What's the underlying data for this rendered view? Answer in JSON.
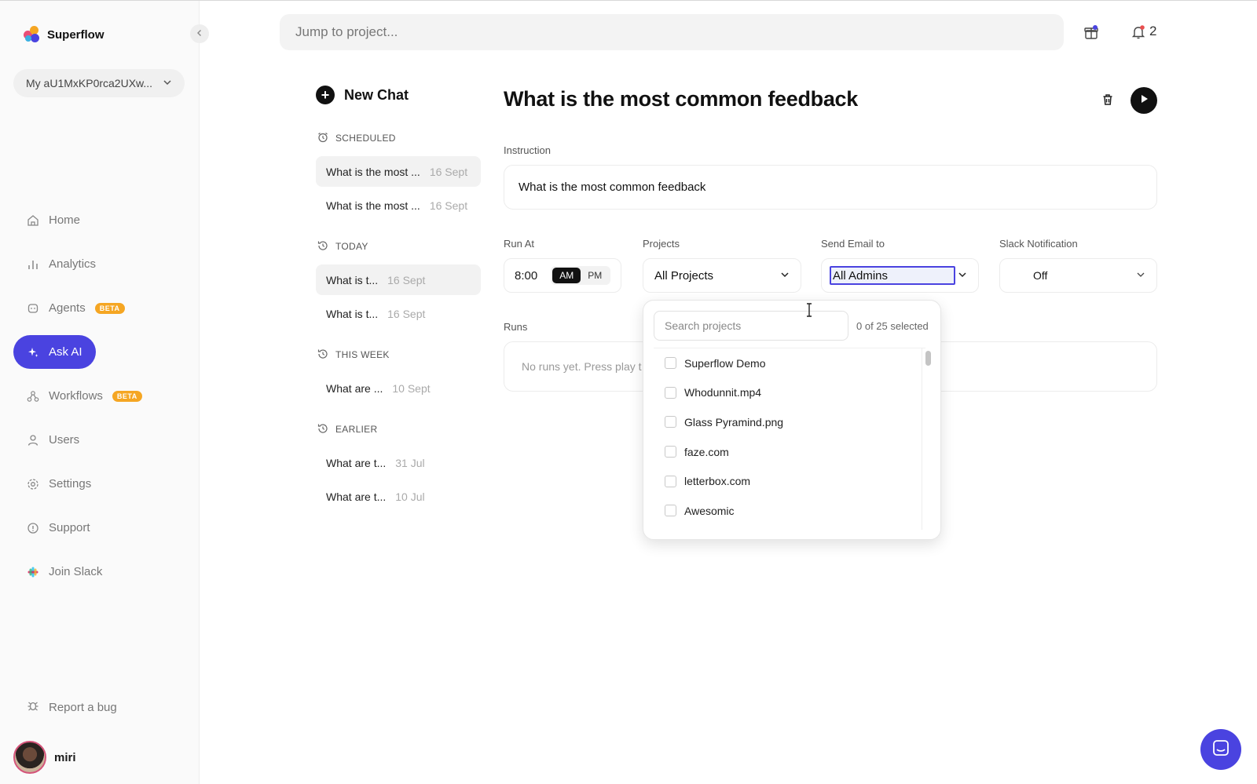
{
  "app": {
    "name": "Superflow",
    "logo_colors": [
      "#f5a623",
      "#e94e77",
      "#4a43e0",
      "#3ab0e2"
    ]
  },
  "sidebar": {
    "workspace": "My aU1MxKP0rca2UXw...",
    "items": [
      {
        "label": "Home",
        "icon": "home-icon"
      },
      {
        "label": "Analytics",
        "icon": "bar-chart-icon"
      },
      {
        "label": "Agents",
        "icon": "agent-icon",
        "badge": "BETA"
      },
      {
        "label": "Ask AI",
        "icon": "sparkle-icon",
        "active": true
      },
      {
        "label": "Workflows",
        "icon": "workflow-icon",
        "badge": "BETA"
      },
      {
        "label": "Users",
        "icon": "user-icon"
      },
      {
        "label": "Settings",
        "icon": "gear-icon"
      },
      {
        "label": "Support",
        "icon": "info-icon"
      },
      {
        "label": "Join Slack",
        "icon": "slack-icon"
      }
    ],
    "report_bug": "Report a bug",
    "user_name": "miri"
  },
  "header": {
    "search_placeholder": "Jump to project...",
    "notification_count": "2"
  },
  "chats": {
    "new_chat": "New Chat",
    "sections": [
      {
        "title": "SCHEDULED",
        "items": [
          {
            "title": "What is the most ...",
            "date": "16 Sept",
            "selected": true
          },
          {
            "title": "What is the most ...",
            "date": "16 Sept",
            "selected": false
          }
        ]
      },
      {
        "title": "TODAY",
        "items": [
          {
            "title": "What is t...",
            "date": "16 Sept",
            "selected": true
          },
          {
            "title": "What is t...",
            "date": "16 Sept",
            "selected": false
          }
        ]
      },
      {
        "title": "THIS WEEK",
        "items": [
          {
            "title": "What are ...",
            "date": "10 Sept",
            "selected": false
          }
        ]
      },
      {
        "title": "EARLIER",
        "items": [
          {
            "title": "What are t...",
            "date": "31 Jul",
            "selected": false
          },
          {
            "title": "What are t...",
            "date": "10 Jul",
            "selected": false
          }
        ]
      }
    ]
  },
  "main": {
    "title": "What is the most common feedback",
    "instruction_label": "Instruction",
    "instruction_value": "What is the most common feedback",
    "run_at_label": "Run At",
    "run_at_time": "8:00",
    "am": "AM",
    "pm": "PM",
    "projects_label": "Projects",
    "projects_value": "All Projects",
    "email_label": "Send Email to",
    "email_value": "All Admins",
    "slack_label": "Slack Notification",
    "slack_value": "Off",
    "runs_label": "Runs",
    "runs_empty": "No runs yet. Press play t"
  },
  "dropdown": {
    "search_placeholder": "Search projects",
    "count": "0 of 25 selected",
    "items": [
      "Superflow Demo",
      "Whodunnit.mp4",
      "Glass Pyramind.png",
      "faze.com",
      "letterbox.com",
      "Awesomic"
    ]
  },
  "colors": {
    "accent": "#4a43e0",
    "beta": "#f5a623"
  }
}
